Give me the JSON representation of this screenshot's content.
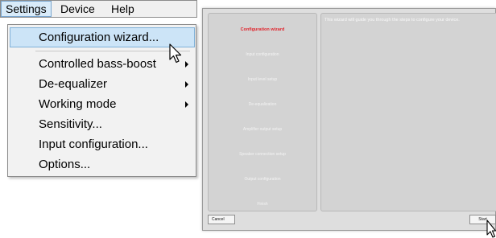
{
  "menubar": {
    "items": [
      {
        "label": "Settings",
        "active": true
      },
      {
        "label": "Device",
        "active": false
      },
      {
        "label": "Help",
        "active": false
      }
    ]
  },
  "settings_menu": {
    "items": [
      {
        "label": "Configuration wizard...",
        "highlighted": true,
        "submenu": false
      },
      {
        "label": "Controlled bass-boost",
        "highlighted": false,
        "submenu": true
      },
      {
        "label": "De-equalizer",
        "highlighted": false,
        "submenu": true
      },
      {
        "label": "Working mode",
        "highlighted": false,
        "submenu": true
      },
      {
        "label": "Sensitivity...",
        "highlighted": false,
        "submenu": false
      },
      {
        "label": "Input configuration...",
        "highlighted": false,
        "submenu": false
      },
      {
        "label": "Options...",
        "highlighted": false,
        "submenu": false
      }
    ]
  },
  "wizard": {
    "steps": [
      {
        "label": "Configuration wizard",
        "current": true
      },
      {
        "label": "Input configuration",
        "current": false
      },
      {
        "label": "Input level setup",
        "current": false
      },
      {
        "label": "De-equalization",
        "current": false
      },
      {
        "label": "Amplifier output setup",
        "current": false
      },
      {
        "label": "Speaker connection setup",
        "current": false
      },
      {
        "label": "Output configuration",
        "current": false
      },
      {
        "label": "Finish",
        "current": false
      }
    ],
    "info_text": "This wizard will guide you through the steps to configure your device.",
    "cancel_label": "Cancel",
    "start_label": "Start"
  },
  "colors": {
    "current_step": "#e0252d",
    "menu_highlight": "#cce4f7",
    "window_bg": "#dedede"
  },
  "icons": {
    "menu_cursor": "arrow-cursor-icon",
    "wizard_cursor": "arrow-cursor-icon"
  }
}
